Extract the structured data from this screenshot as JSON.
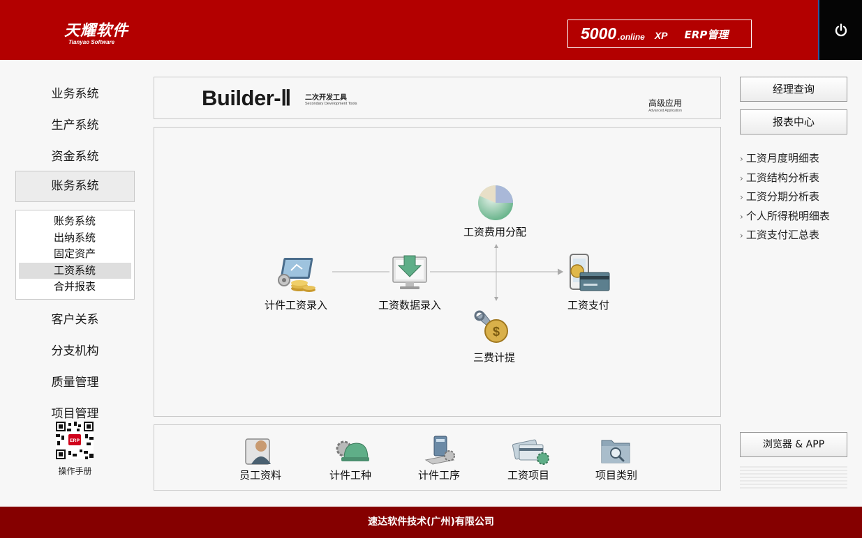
{
  "header": {
    "logo_cn": "天耀软件",
    "logo_en": "Tianyao Software",
    "product_num": "5000",
    "product_online": ".online",
    "product_xp": "XP",
    "product_erp": "ERP管理"
  },
  "nav": {
    "items": [
      "业务系统",
      "生产系统",
      "资金系统",
      "账务系统",
      "客户关系",
      "分支机构",
      "质量管理",
      "项目管理"
    ],
    "active": "账务系统",
    "sub_items": [
      "账务系统",
      "出纳系统",
      "固定资产",
      "工资系统",
      "合并报表"
    ],
    "sub_selected": "工资系统",
    "manual_label": "操作手册"
  },
  "banner": {
    "title": "Builder-Ⅱ",
    "subtitle_cn": "二次开发工具",
    "subtitle_en": "Secondary Development Tools",
    "advanced_cn": "高级应用",
    "advanced_en": "Advanced Application"
  },
  "flow": {
    "piece_wage_entry": "计件工资录入",
    "wage_data_entry": "工资数据录入",
    "wage_cost_allocation": "工资费用分配",
    "three_fees": "三费计提",
    "wage_payment": "工资支付"
  },
  "bottom": {
    "items": [
      "员工资料",
      "计件工种",
      "计件工序",
      "工资项目",
      "项目类别"
    ]
  },
  "right": {
    "manager_query": "经理查询",
    "report_center": "报表中心",
    "reports": [
      "工资月度明细表",
      "工资结构分析表",
      "工资分期分析表",
      "个人所得税明细表",
      "工资支付汇总表"
    ],
    "browser_app": "浏览器 & APP"
  },
  "footer": {
    "company": "速达软件技术(广州)有限公司"
  },
  "colors": {
    "header_red": "#b30000",
    "footer_red": "#850000",
    "power_bg": "#050505"
  }
}
